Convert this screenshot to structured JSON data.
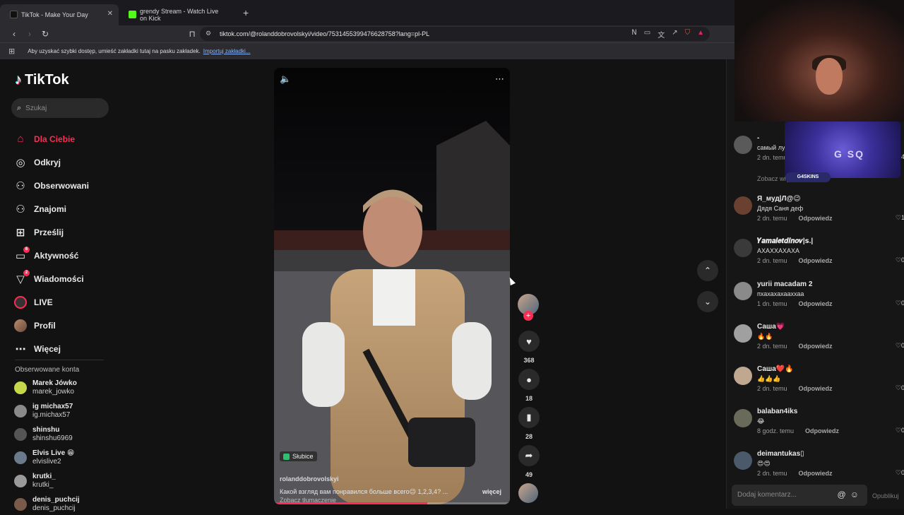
{
  "browser": {
    "tabs": [
      {
        "title": "TikTok - Make Your Day",
        "active": true,
        "fav_color": "#111111"
      },
      {
        "title": "grendy Stream - Watch Live on Kick",
        "active": false,
        "fav_color": "#53fc18"
      }
    ],
    "url": "tiktok.com/@rolanddobrovolskyi/video/7531455399476628758?lang=pl-PL",
    "bookmarks_text": "Aby uzyskać szybki dostęp, umieść zakładki tutaj na pasku zakładek.",
    "bookmarks_link": "Importuj zakładki..."
  },
  "tiktok": {
    "logo": "TikTok",
    "search_placeholder": "Szukaj",
    "nav": [
      {
        "label": "Dla Ciebie",
        "icon": "home-icon",
        "glyph": "⌂",
        "active": true
      },
      {
        "label": "Odkryj",
        "icon": "compass-icon",
        "glyph": "◎"
      },
      {
        "label": "Obserwowani",
        "icon": "following-icon",
        "glyph": "⚇"
      },
      {
        "label": "Znajomi",
        "icon": "friends-icon",
        "glyph": "⚇"
      },
      {
        "label": "Prześlij",
        "icon": "upload-icon",
        "glyph": "⊞"
      },
      {
        "label": "Aktywność",
        "icon": "activity-icon",
        "glyph": "▭",
        "badge": "6"
      },
      {
        "label": "Wiadomości",
        "icon": "messages-icon",
        "glyph": "▽",
        "badge": "2"
      },
      {
        "label": "LIVE",
        "icon": "live-icon"
      },
      {
        "label": "Profil",
        "icon": "profile-icon"
      },
      {
        "label": "Więcej",
        "icon": "more-icon",
        "glyph": "⋯"
      }
    ],
    "followed_title": "Obserwowane konta",
    "followed": [
      {
        "name": "Marek Jówko",
        "handle": "marek_jowko",
        "color": "#c6d84a"
      },
      {
        "name": "ig michax57",
        "handle": "ig.michax57",
        "color": "#8a8a8a"
      },
      {
        "name": "shinshu",
        "handle": "shinshu6969",
        "color": "#555555"
      },
      {
        "name": "Elvis Live 😁",
        "handle": "elvislive2",
        "color": "#6a7a8a"
      },
      {
        "name": "krutki_",
        "handle": "krutki_",
        "color": "#9a9a9a"
      },
      {
        "name": "denis_puchcij",
        "handle": "denis_puchcij",
        "color": "#7a5a4a"
      }
    ]
  },
  "video": {
    "location": "Słubice",
    "author": "rolanddobrovolskyi",
    "description": "Какой взгляд вам понравился больше всего😉 1,2,3,4? ...",
    "more_label": "więcej",
    "translate_label": "Zobacz tłumaczenie",
    "progress": 0.65,
    "counts": {
      "likes": "368",
      "comments": "18",
      "saves": "28",
      "shares": "49"
    }
  },
  "comments": {
    "view_more": "Zobacz więcej",
    "items": [
      {
        "user": "-",
        "text": "самый лу",
        "time": "2 dn. temu",
        "reply": "Odpowiedz",
        "likes": "4",
        "color": "#5a5a5a"
      },
      {
        "user": "Я_муд|Л@😉",
        "text": "Дядя Саня деф",
        "time": "2 dn. temu",
        "reply": "Odpowiedz",
        "likes": "1",
        "color": "#6a4030"
      },
      {
        "user": "𝒀𝒂𝒎𝒂𝒍𝒆𝒕𝒅𝒊𝒏𝒐𝒗|ꜱ.|",
        "text": "АХАХХАХАХА",
        "time": "2 dn. temu",
        "reply": "Odpowiedz",
        "likes": "0",
        "color": "#3a3a3a"
      },
      {
        "user": "yurii macadam 2",
        "text": "пхахахахааххаа",
        "time": "1 dn. temu",
        "reply": "Odpowiedz",
        "likes": "0",
        "color": "#8a8a8a"
      },
      {
        "user": "Саша💗",
        "text": "🔥🔥",
        "time": "2 dn. temu",
        "reply": "Odpowiedz",
        "likes": "0",
        "color": "#a0a0a0"
      },
      {
        "user": "Саша❤️🔥",
        "text": "👍👍👍",
        "time": "2 dn. temu",
        "reply": "Odpowiedz",
        "likes": "0",
        "color": "#c0a890"
      },
      {
        "user": "balaban4iks",
        "text": "😂",
        "time": "8 godz. temu",
        "reply": "Odpowiedz",
        "likes": "0",
        "color": "#6a6a5a"
      },
      {
        "user": "deimantukas▯",
        "text": "😍😍",
        "time": "2 dn. temu",
        "reply": "Odpowiedz",
        "likes": "0",
        "color": "#4a5a6a"
      }
    ],
    "input_placeholder": "Dodaj komentarz...",
    "post_label": "Opublikuj"
  },
  "overlay": {
    "gsq": "G SQ",
    "skins": "G4SKINS"
  }
}
